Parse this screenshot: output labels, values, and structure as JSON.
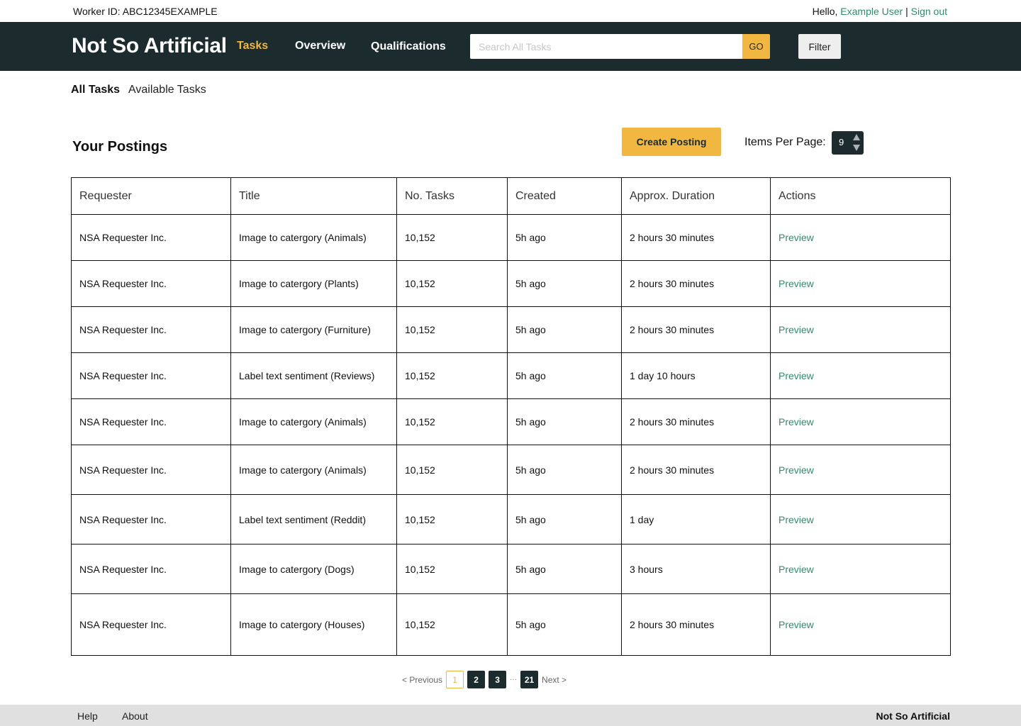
{
  "topbar": {
    "worker_id": "Worker ID: ABC12345EXAMPLE",
    "hello": "Hello, ",
    "user_name": "Example User",
    "separator": " | ",
    "sign_out": "Sign out"
  },
  "header": {
    "logo": "Not So Artificial",
    "nav": [
      "Tasks",
      "Overview",
      "Qualifications"
    ],
    "active_nav": "Tasks",
    "search_placeholder": "Search All Tasks",
    "go_label": "GO",
    "filter_label": "Filter"
  },
  "subtabs": [
    "All Tasks",
    "Available Tasks"
  ],
  "section": {
    "title": "Your Postings",
    "create_label": "Create Posting",
    "items_per_page_label": "Items Per Page:",
    "items_per_page_value": "9"
  },
  "table": {
    "columns": [
      "Requester",
      "Title",
      "No. Tasks",
      "Created",
      "Approx. Duration",
      "Actions"
    ],
    "rows": [
      [
        "NSA Requester Inc.",
        "Image to catergory (Animals)",
        "10,152",
        "5h ago",
        "2 hours 30 minutes",
        "Preview"
      ],
      [
        "NSA Requester Inc.",
        "Image to catergory (Plants)",
        "10,152",
        "5h ago",
        "2 hours 30 minutes",
        "Preview"
      ],
      [
        "NSA Requester Inc.",
        "Image to catergory (Furniture)",
        "10,152",
        "5h ago",
        "2 hours 30 minutes",
        "Preview"
      ],
      [
        "NSA Requester Inc.",
        "Label text sentiment (Reviews)",
        "10,152",
        "5h ago",
        "1 day 10 hours",
        "Preview"
      ],
      [
        "NSA Requester Inc.",
        "Image to catergory (Animals)",
        "10,152",
        "5h ago",
        "2 hours 30 minutes",
        "Preview"
      ],
      [
        "NSA Requester Inc.",
        "Image to catergory (Animals)",
        "10,152",
        "5h ago",
        "2 hours 30 minutes",
        "Preview"
      ],
      [
        "NSA Requester Inc.",
        "Label text sentiment (Reddit)",
        "10,152",
        "5h ago",
        "1 day",
        "Preview"
      ],
      [
        "NSA Requester Inc.",
        "Image to catergory (Dogs)",
        "10,152",
        "5h ago",
        "3 hours",
        "Preview"
      ],
      [
        "NSA Requester Inc.",
        "Image to catergory (Houses)",
        "10,152",
        "5h ago",
        "2 hours 30 minutes",
        "Preview"
      ]
    ]
  },
  "pagination": {
    "previous": "< Previous",
    "pages": [
      "1",
      "2",
      "3"
    ],
    "ellipsis": "···",
    "last": "21",
    "next": "Next >",
    "current": "1"
  },
  "footer": {
    "help": "Help",
    "about": "About",
    "brand": "Not So Artificial"
  },
  "colors": {
    "header_bg": "#1c2b2e",
    "accent": "#f2b740",
    "link": "#2e8b6f",
    "footer_bg": "#e0e0e0"
  }
}
